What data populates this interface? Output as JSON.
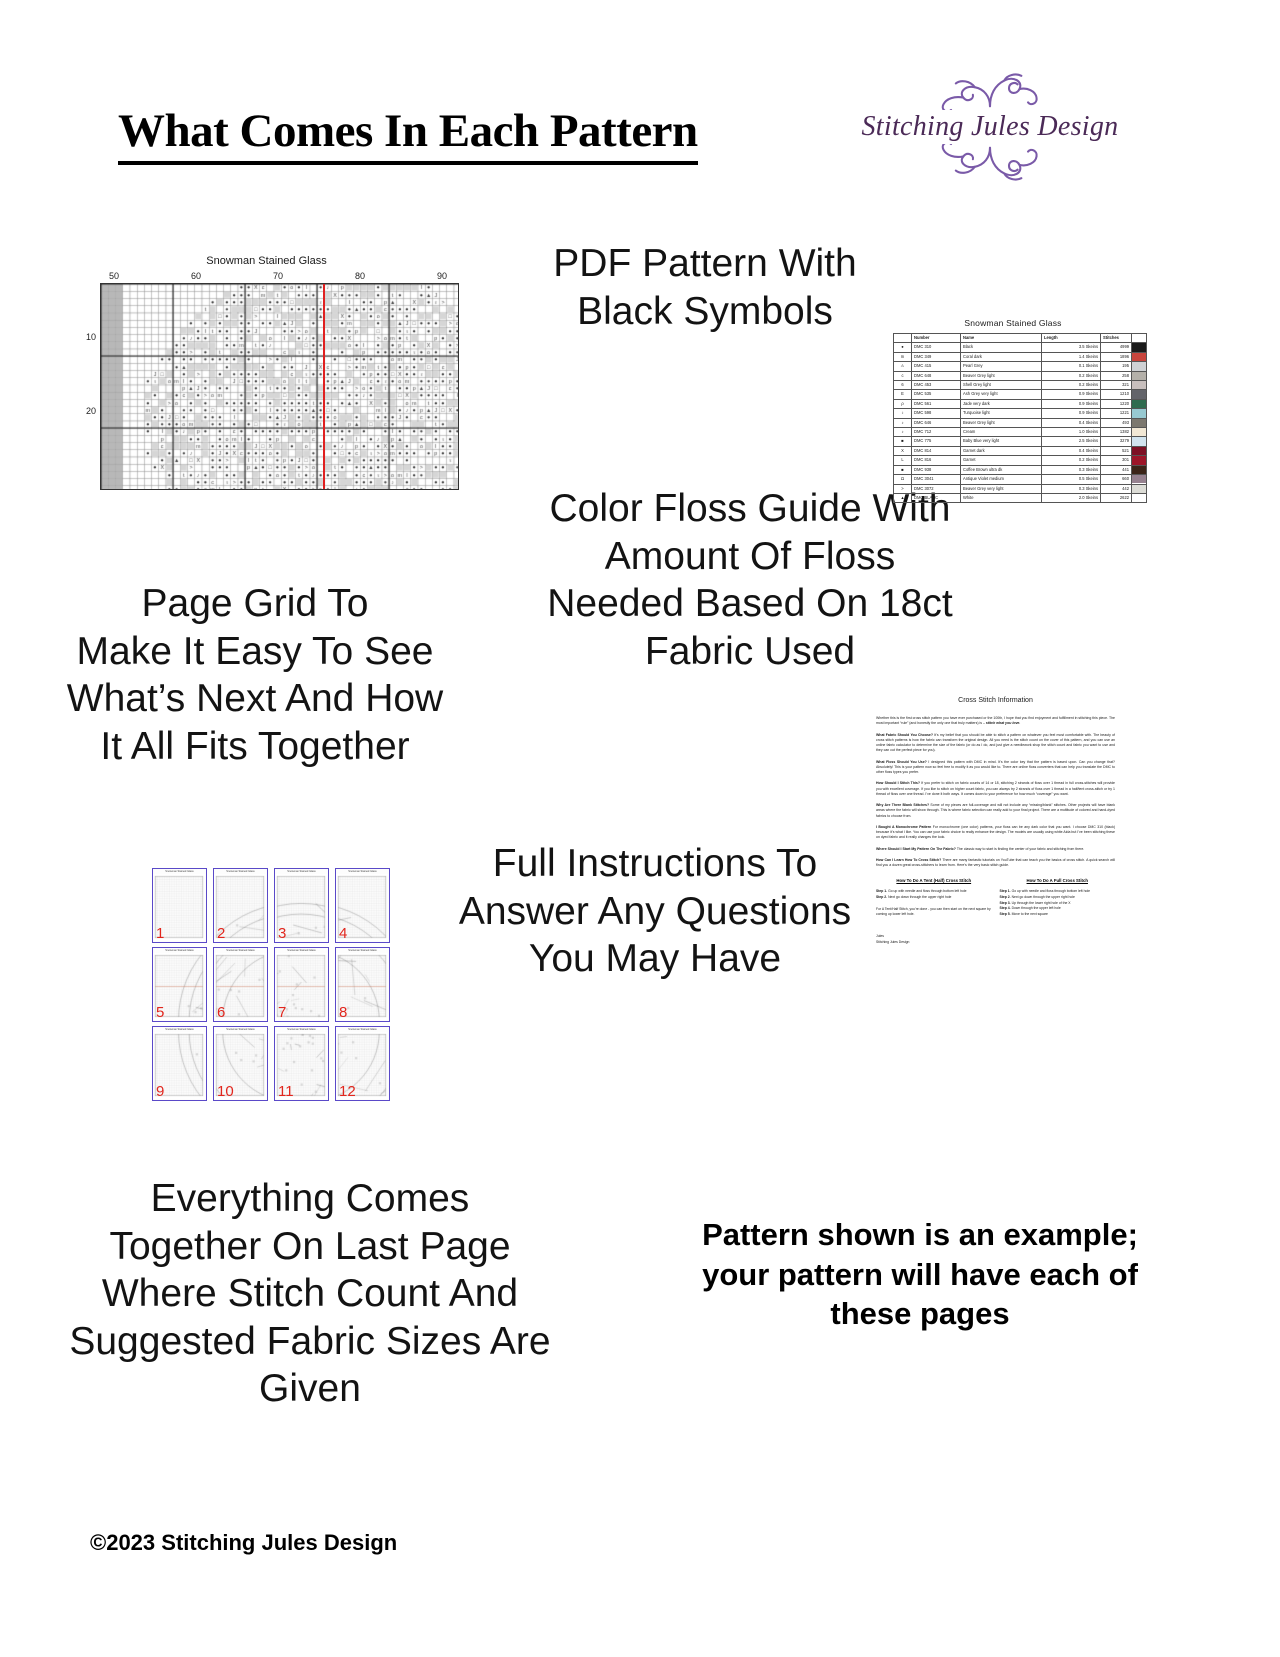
{
  "header": {
    "title": "What Comes In Each Pattern",
    "brand_name": "Stitching Jules Design",
    "brand_color": "#4b2a57",
    "flourish_color": "#7a5aa8"
  },
  "captions": {
    "pdf": "PDF Pattern With\nBlack Symbols",
    "page_grid": "Page Grid To\nMake It Easy To See\nWhat’s Next And How\nIt All Fits Together",
    "floss": "Color Floss Guide With\nAmount Of Floss\nNeeded Based On 18ct\nFabric Used",
    "instructions": "Full Instructions To\nAnswer Any Questions\nYou May Have",
    "last_page": "Everything Comes\nTogether On Last Page\nWhere Stitch Count And\nSuggested Fabric Sizes Are\nGiven",
    "note": "Pattern shown is an example; your pattern will have each of these pages"
  },
  "copyright": "©2023 Stitching Jules Design",
  "chart_preview": {
    "title": "Snowman Stained Glass",
    "column_labels": [
      "50",
      "60",
      "70",
      "80",
      "90"
    ],
    "row_labels": [
      "10",
      "20"
    ],
    "center_line_color": "#e02020",
    "center_marker": "down-triangle"
  },
  "floss_table": {
    "title": "Snowman Stained Glass",
    "columns": [
      "",
      "Number",
      "Name",
      "Length",
      "Stitches",
      ""
    ],
    "rows": [
      {
        "symbol": "●",
        "number": "DMC   310",
        "name": "Black",
        "length": "3.5 Skeins",
        "stitches": "4999",
        "color": "#1a1a1a"
      },
      {
        "symbol": "m",
        "number": "DMC   349",
        "name": "Coral dark",
        "length": "1.4 Skeins",
        "stitches": "1896",
        "color": "#c8453d"
      },
      {
        "symbol": "⚠",
        "number": "DMC   415",
        "name": "Pearl Grey",
        "length": "0.1 Skeins",
        "stitches": "195",
        "color": "#cfd1d4"
      },
      {
        "symbol": "c",
        "number": "DMC   648",
        "name": "Beaver Grey light",
        "length": "0.2 Skeins",
        "stitches": "258",
        "color": "#b4b0a9"
      },
      {
        "symbol": "6",
        "number": "DMC   453",
        "name": "Shell Grey light",
        "length": "0.2 Skeins",
        "stitches": "321",
        "color": "#c8bfbd"
      },
      {
        "symbol": "E",
        "number": "DMC   535",
        "name": "Ash Grey very light",
        "length": "0.9 Skeins",
        "stitches": "1210",
        "color": "#63646a"
      },
      {
        "symbol": "ρ",
        "number": "DMC   561",
        "name": "Jade very dark",
        "length": "0.9 Skeins",
        "stitches": "1220",
        "color": "#2f6b4f"
      },
      {
        "symbol": "♀",
        "number": "DMC   598",
        "name": "Turquoise light",
        "length": "0.9 Skeins",
        "stitches": "1221",
        "color": "#97c9d1"
      },
      {
        "symbol": "♪",
        "number": "DMC   646",
        "name": "Beaver Grey light",
        "length": "0.4 Skeins",
        "stitches": "493",
        "color": "#7c786f"
      },
      {
        "symbol": "♪",
        "number": "DMC   712",
        "name": "Cream",
        "length": "1.0 Skeins",
        "stitches": "1382",
        "color": "#f2e8d5"
      },
      {
        "symbol": "■",
        "number": "DMC   775",
        "name": "Baby Blue very light",
        "length": "2.5 Skeins",
        "stitches": "3279",
        "color": "#d2e4ef"
      },
      {
        "symbol": "X",
        "number": "DMC   814",
        "name": "Garnet dark",
        "length": "0.4 Skeins",
        "stitches": "521",
        "color": "#7d1024"
      },
      {
        "symbol": "L",
        "number": "DMC   816",
        "name": "Garnet",
        "length": "0.2 Skeins",
        "stitches": "301",
        "color": "#9c1528"
      },
      {
        "symbol": "■",
        "number": "DMC   938",
        "name": "Coffee Brown ultra dk",
        "length": "0.3 Skeins",
        "stitches": "441",
        "color": "#3b2418"
      },
      {
        "symbol": "Ω",
        "number": "DMC   3041",
        "name": "Antique Violet medium",
        "length": "0.5 Skeins",
        "stitches": "660",
        "color": "#96818f"
      },
      {
        "symbol": ">",
        "number": "DMC   3072",
        "name": "Beaver Grey very light",
        "length": "0.3 Skeins",
        "stitches": "442",
        "color": "#dcdcd6"
      },
      {
        "symbol": "▲",
        "number": "DMC   BLANC",
        "name": "White",
        "length": "2.0 Skeins",
        "stitches": "2622",
        "color": "#ffffff"
      }
    ]
  },
  "page_grid": {
    "thumb_title": "Snowman Stained Glass",
    "pages": [
      "1",
      "2",
      "3",
      "4",
      "5",
      "6",
      "7",
      "8",
      "9",
      "10",
      "11",
      "12"
    ],
    "border_color": "#5a49c8",
    "number_color": "#e1261d"
  },
  "instructions_doc": {
    "title": "Cross Stitch Information",
    "intro": "Whether this is the first cross stitch pattern you have ever purchased or the 100th, I hope that you find enjoyment and fulfillment in stitching this piece. The most important “rule” (and honestly the only one that truly matters) is – stitch what you love.",
    "intro_emphasis": "stitch what you love.",
    "sections": [
      {
        "heading": "What Fabric Should You Choose?",
        "body": " It’s my belief that you should be able to stitch a pattern on whatever you feel most comfortable with. The beauty of cross stitch patterns is how the fabric can transform the original design.  All you need is the stitch count on the cover of this pattern, and you can use an online fabric calculator to determine the size of the fabric (or do as I do, and just give a needlework shop the stitch count and fabric you want to use and they can cut the perfect piece for you)."
      },
      {
        "heading": "What Floss Should You Use?",
        "body": " I designed this pattern with DMC in mind. It’s the color key that the pattern is based upon. Can you change that? Absolutely! This is your pattern now so feel free to modify it as you would like to.  There are online floss converters that can help you translate the DMC to other floss types you prefer."
      },
      {
        "heading": "How Should I Stitch This?",
        "body": " If you prefer to stitch on fabric counts of 14 or 18, stitching 2 strands of floss over 1 thread in full cross-stitches will provide you with excellent coverage. If you like to stitch on higher count fabric, you can always try 2 strands of floss over 1 thread in a half/tent cross-stitch or try 1 thread of floss over one thread. I’ve done it both ways. It comes down to your preference for how much “coverage” you want."
      },
      {
        "heading": "Why Are There Blank Stitches?",
        "body": " Some of my pieces are full-coverage and will not include any “missing/blank” stitches. Other projects will have blank areas where the fabric will show through. This is where fabric selection can really add to your final project. There are a multitude of colored and hand-dyed fabrics to choose from."
      },
      {
        "heading": "I Bought A Monochrome Pattern",
        "body": " For monochrome (one color) patterns, your floss can be any dark color that you want. I choose DMC 310 (black) because it’s what I like. You can use your fabric choice to really enhance the design. The models are usually using white Aida but I’ve been stitching these on dyed fabric and it really changes the look."
      },
      {
        "heading": "Where Should I Start My Pattern On The Fabric?",
        "body": " The classic way to start is finding the center of your fabric and stitching from there."
      },
      {
        "heading": "How Can I Learn How To Cross Stitch?",
        "body": " There are many fantastic tutorials on YouTube that can teach you the basics of cross stitch. A quick search will find you a dozen great cross-stitchers to learn from. Here’s the very basic stitch guide."
      }
    ],
    "half_stitch": {
      "heading": "How To Do A Tent (Half) Cross Stitch",
      "steps": [
        "Step 1. Go up with needle and floss through bottom left hole",
        "Step 2. Next go down through the upper right hole"
      ],
      "note": "For A Tent/Half Stitch, you’re done - you can then start on the next square by coming up lower left hole."
    },
    "full_stitch": {
      "heading": "How To Do A Full Cross Stitch",
      "steps": [
        "Step 1. Go up with needle and floss through bottom left hole",
        "Step 2. Next go down through the upper right hole",
        "Step 3. Up through the lower right hole of the X",
        "Step 4. Down through the upper left hole",
        "Step 5. Move to the next square"
      ]
    },
    "signature_line1": "Jules",
    "signature_line2": "Stitching Jules Design"
  }
}
